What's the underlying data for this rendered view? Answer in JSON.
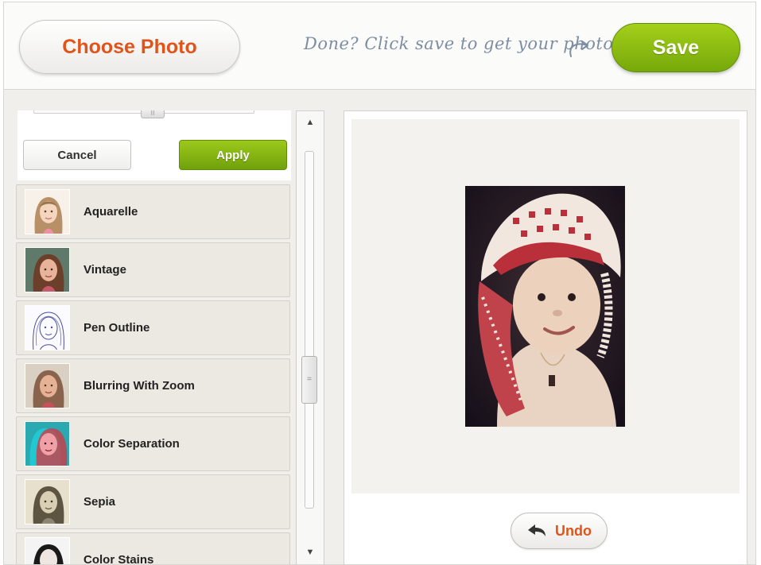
{
  "header": {
    "choose_label": "Choose Photo",
    "hint": "Done? Click save to get your photo!",
    "save_label": "Save"
  },
  "settings": {
    "slider_grip": "II",
    "cancel_label": "Cancel",
    "apply_label": "Apply"
  },
  "effects": [
    {
      "label": "Aquarelle",
      "thumb": "woman-portrait-watercolor"
    },
    {
      "label": "Vintage",
      "thumb": "woman-portrait-vintage"
    },
    {
      "label": "Pen Outline",
      "thumb": "woman-portrait-sketch"
    },
    {
      "label": "Blurring With Zoom",
      "thumb": "woman-portrait-blur"
    },
    {
      "label": "Color Separation",
      "thumb": "woman-portrait-anaglyph"
    },
    {
      "label": "Sepia",
      "thumb": "woman-portrait-sepia"
    },
    {
      "label": "Color Stains",
      "thumb": "woman-portrait-stains"
    }
  ],
  "scrollbar": {
    "up_arrow": "▲",
    "down_arrow": "▼",
    "thumb_grip": "="
  },
  "preview": {
    "photo": "baby-in-red-white-keffiyeh"
  },
  "undo": {
    "label": "Undo"
  },
  "colors": {
    "accent_orange": "#e0541a",
    "accent_green": "#84b510",
    "hint_text": "#7d8da3"
  }
}
